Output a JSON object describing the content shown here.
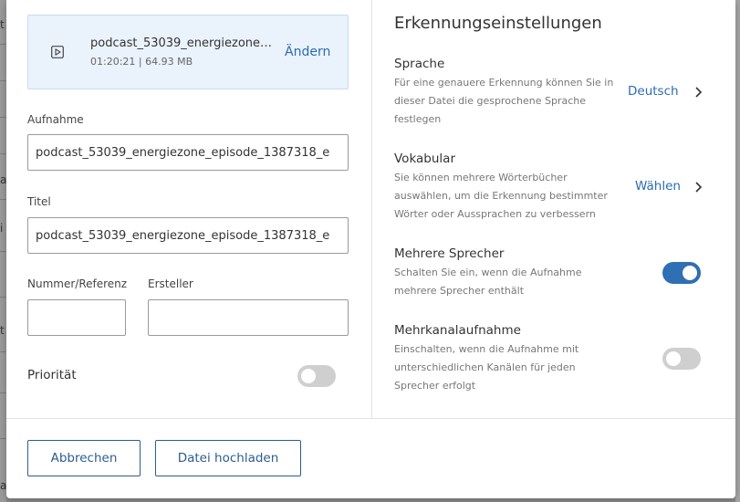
{
  "background": {
    "row_fragments": [
      "t",
      "",
      "",
      "a",
      "",
      "i",
      "",
      "",
      "t",
      "",
      "",
      "a"
    ]
  },
  "file": {
    "name": "podcast_53039_energiezone_episode_1387318_e",
    "meta": "01:20:21 | 64.93 MB",
    "change_label": "Ändern",
    "icon": "play-file-icon"
  },
  "form": {
    "recording_label": "Aufnahme",
    "recording_value": "podcast_53039_energiezone_episode_1387318_e",
    "title_label": "Titel",
    "title_value": "podcast_53039_energiezone_episode_1387318_e",
    "reference_label": "Nummer/Referenz",
    "reference_value": "",
    "creator_label": "Ersteller",
    "creator_value": "",
    "priority_label": "Priorität",
    "priority_enabled": false
  },
  "settings": {
    "heading": "Erkennungseinstellungen",
    "language": {
      "title": "Sprache",
      "description": "Für eine genauere Erkennung können Sie in dieser Datei die gesprochene Sprache festlegen",
      "value": "Deutsch"
    },
    "vocabulary": {
      "title": "Vokabular",
      "description": "Sie können mehrere Wörterbücher auswählen, um die Erkennung bestimmter Wörter oder Aussprachen zu verbessern",
      "action": "Wählen"
    },
    "multi_speaker": {
      "title": "Mehrere Sprecher",
      "description": "Schalten Sie ein, wenn die Aufnahme mehrere Sprecher enthält",
      "enabled": true
    },
    "multichannel": {
      "title": "Mehrkanalaufnahme",
      "description": "Einschalten, wenn die Aufnahme mit unterschiedlichen Kanälen für jeden Sprecher erfolgt",
      "enabled": false
    }
  },
  "footer": {
    "cancel_label": "Abbrechen",
    "upload_label": "Datei hochladen"
  },
  "colors": {
    "accent": "#2b6cb0",
    "toggle_on": "#2f6fb4",
    "toggle_off": "#cfcfcf",
    "card_bg": "#eaf2fb"
  }
}
